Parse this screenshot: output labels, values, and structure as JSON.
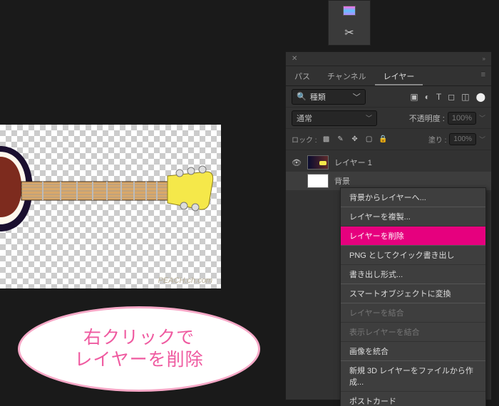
{
  "toolbar_top": {
    "scissor_glyph": "✂"
  },
  "panel": {
    "tabs": [
      {
        "label": "パス"
      },
      {
        "label": "チャンネル"
      },
      {
        "label": "レイヤー"
      }
    ],
    "search_label": "種類",
    "blend_mode": "通常",
    "opacity_label": "不透明度 :",
    "opacity_value": "100%",
    "lock_label": "ロック :",
    "fill_label": "塗り :",
    "fill_value": "100%",
    "layers": [
      {
        "name": "レイヤー 1"
      },
      {
        "name": "背景"
      }
    ]
  },
  "context_menu": [
    {
      "label": "背景からレイヤーへ...",
      "group": true
    },
    {
      "label": "レイヤーを複製...",
      "group": true
    },
    {
      "label": "レイヤーを削除",
      "highlight": true
    },
    {
      "label": "PNG としてクイック書き出し",
      "group": true
    },
    {
      "label": "書き出し形式..."
    },
    {
      "label": "スマートオブジェクトに変換",
      "group": true
    },
    {
      "label": "レイヤーを結合",
      "disabled": true,
      "group": true
    },
    {
      "label": "表示レイヤーを結合",
      "disabled": true
    },
    {
      "label": "画像を統合"
    },
    {
      "label": "新規 3D レイヤーをファイルから作成...",
      "group": true
    },
    {
      "label": "ポストカード"
    }
  ],
  "bubble": {
    "line1": "右クリックで",
    "line2": "レイヤーを削除"
  },
  "watermark": "PEACH.ch.com"
}
